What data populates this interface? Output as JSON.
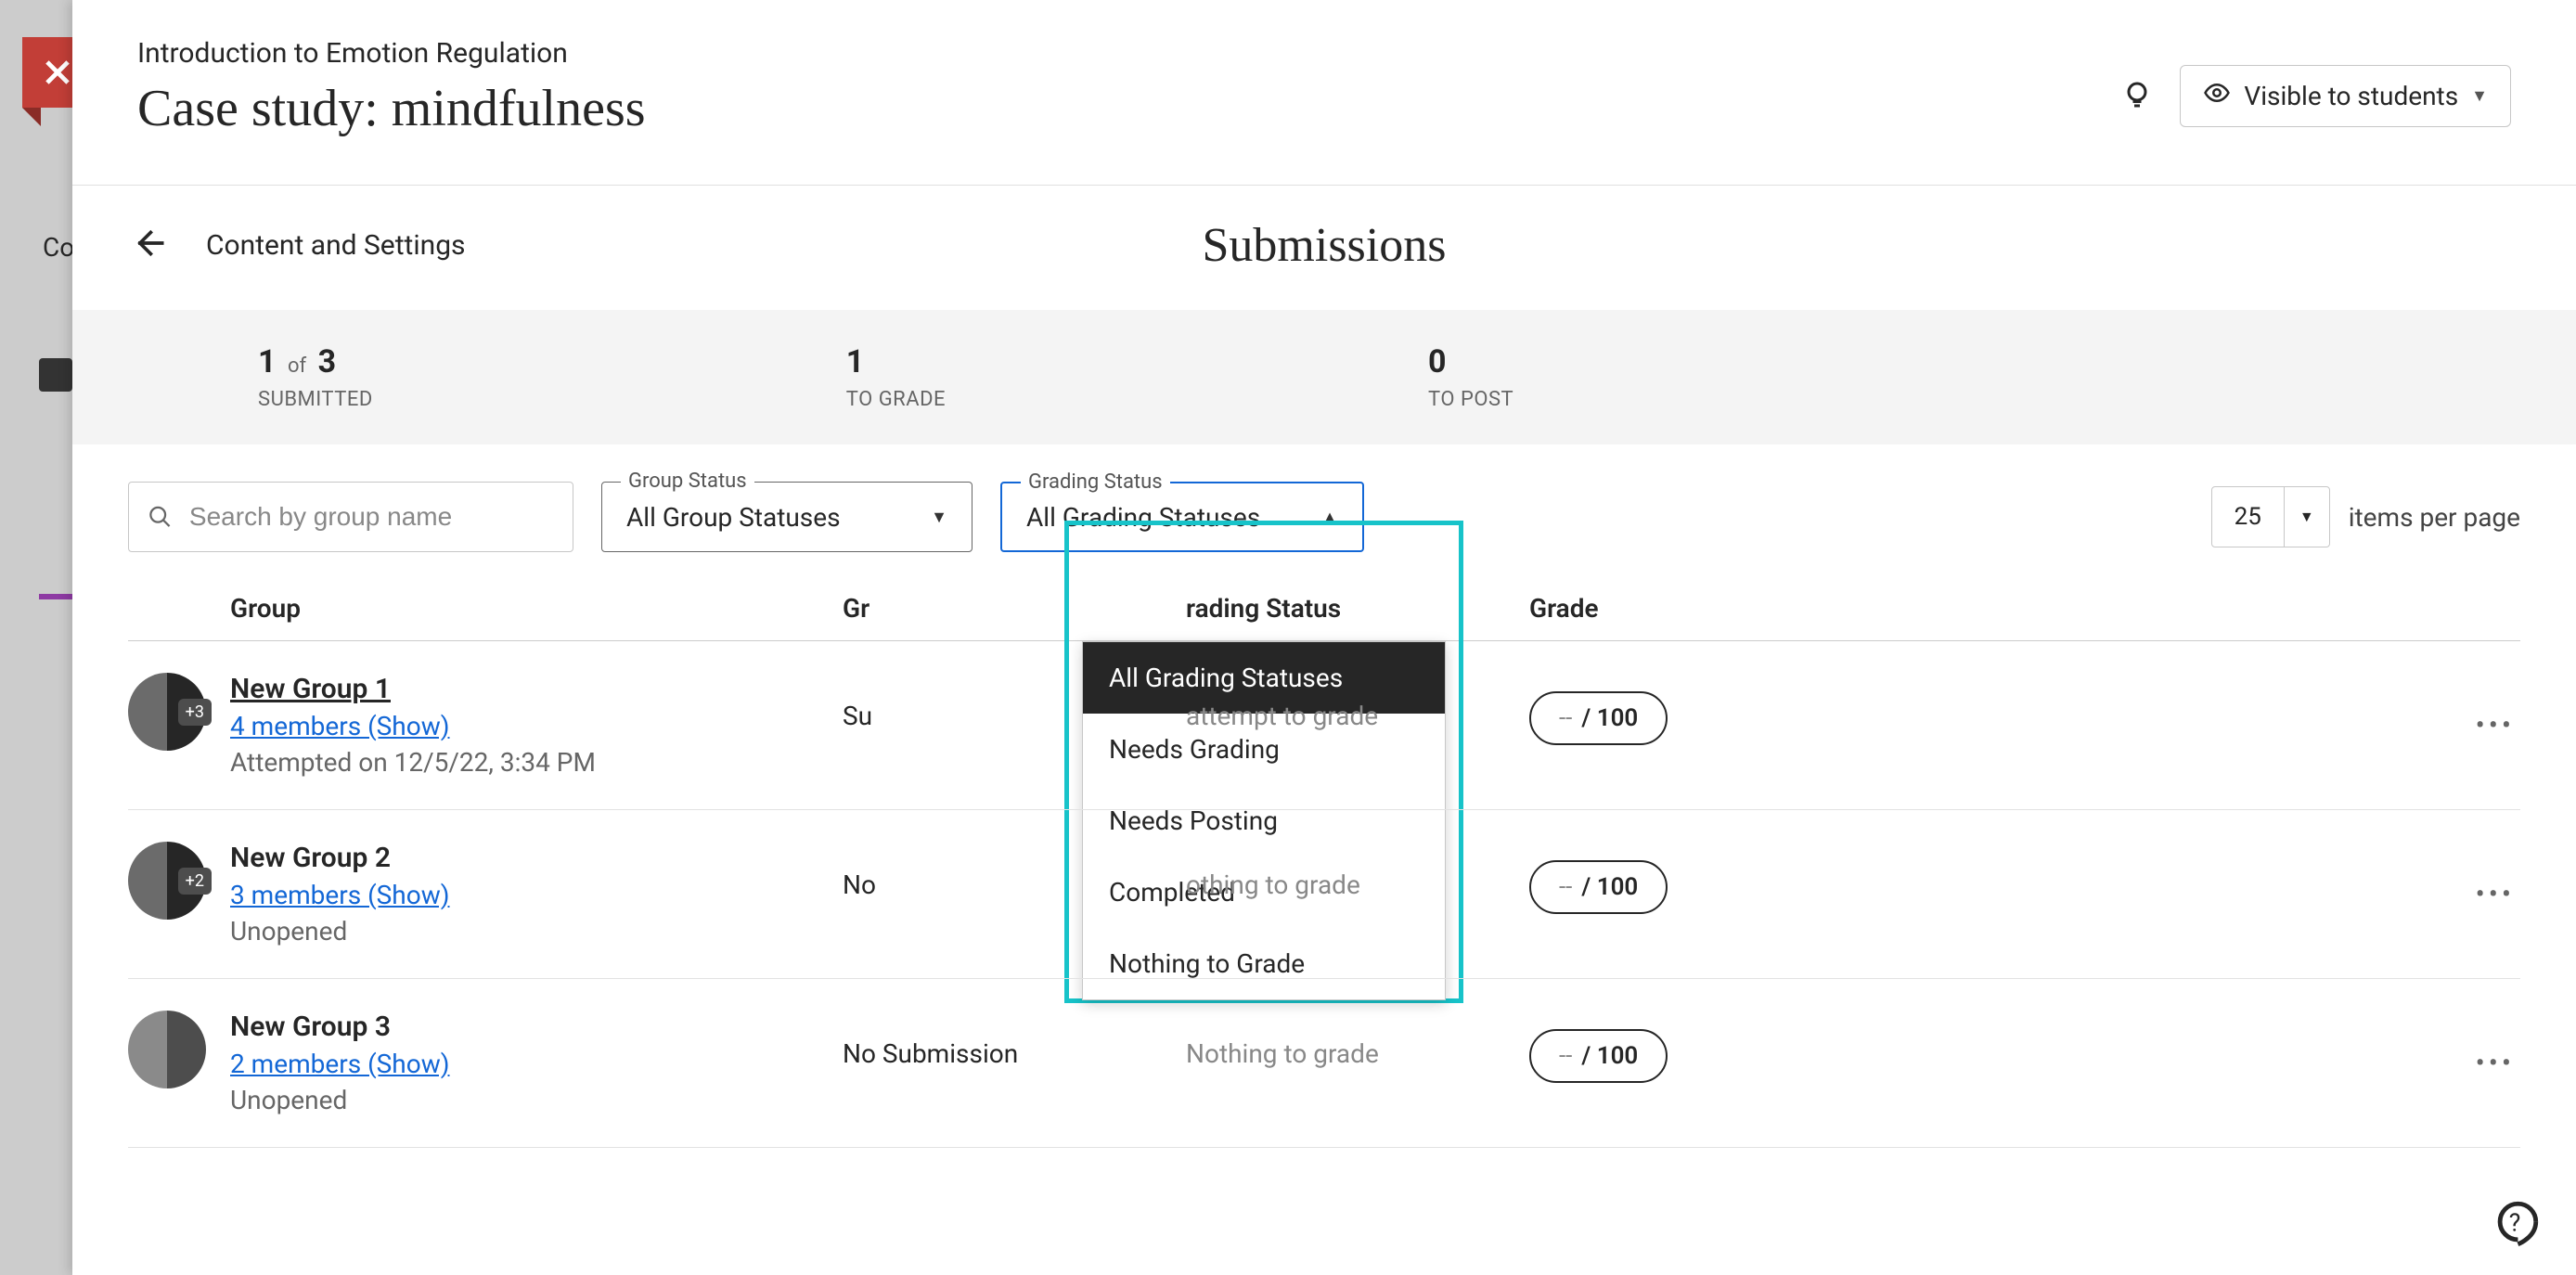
{
  "course_name": "Introduction to Emotion Regulation",
  "page_title": "Case study: mindfulness",
  "visibility_label": "Visible to students",
  "back_label": "Content and Settings",
  "section_title": "Submissions",
  "stats": {
    "submitted_n": "1",
    "submitted_of": "of",
    "submitted_total": "3",
    "submitted_label": "SUBMITTED",
    "tograde_n": "1",
    "tograde_label": "TO GRADE",
    "topost_n": "0",
    "topost_label": "TO POST"
  },
  "search_placeholder": "Search by group name",
  "filters": {
    "group_status_label": "Group Status",
    "group_status_value": "All Group Statuses",
    "grading_status_label": "Grading Status",
    "grading_status_value": "All Grading Statuses",
    "grading_options": {
      "o0": "All Grading Statuses",
      "o1": "Needs Grading",
      "o2": "Needs Posting",
      "o3": "Completed",
      "o4": "Nothing to Grade"
    }
  },
  "pager": {
    "value": "25",
    "label": "items per page"
  },
  "columns": {
    "group": "Group",
    "group_status_partial_left": "Gr",
    "grading_status_partial_right": "rading Status",
    "grade": "Grade"
  },
  "rows": [
    {
      "badge": "+3",
      "name": "New Group 1",
      "name_link": true,
      "members": "4 members (Show)",
      "sub": "Attempted on 12/5/22, 3:34 PM",
      "status_partial": "Su",
      "grading_partial": "attempt to grade",
      "grade": {
        "dash": "--",
        "slash": "/ 100"
      }
    },
    {
      "badge": "+2",
      "name": "New Group 2",
      "members": "3 members (Show)",
      "sub": "Unopened",
      "status_partial": "No",
      "grading_partial": "othing to grade",
      "grade": {
        "dash": "--",
        "slash": "/ 100"
      }
    },
    {
      "badge": "",
      "name": "New Group 3",
      "members": "2 members (Show)",
      "sub": "Unopened",
      "status_full": "No Submission",
      "grading_full": "Nothing to grade",
      "grade": {
        "dash": "--",
        "slash": "/ 100"
      }
    }
  ],
  "bg_text": "Co"
}
